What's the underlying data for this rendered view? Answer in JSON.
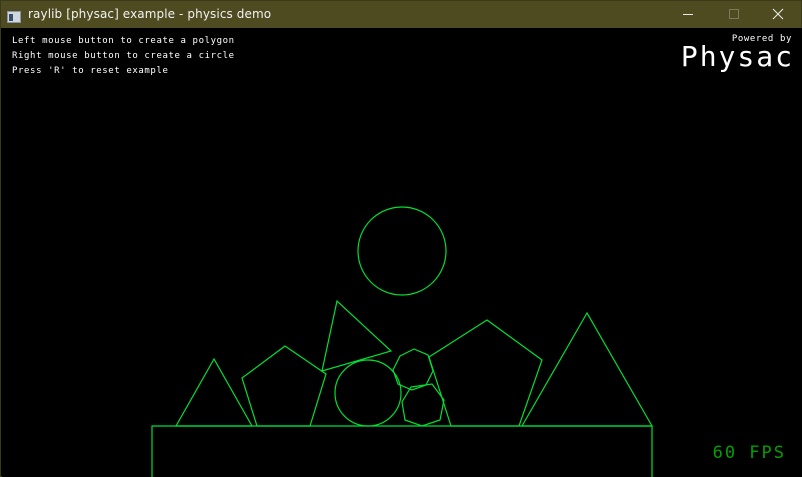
{
  "window": {
    "title": "raylib [physac] example - physics demo",
    "icon": "app-window-icon",
    "controls": [
      "minimize-icon",
      "maximize-icon",
      "close-icon"
    ]
  },
  "instructions": [
    "Left mouse button to create a polygon",
    "Right mouse button to create a circle",
    "Press 'R' to reset example"
  ],
  "logo": {
    "subtitle": "Powered by",
    "name": "Physac"
  },
  "fps_text": "60 FPS",
  "colors": {
    "titlebar": "#4d4b1f",
    "shape_outline": "#00e030",
    "fps": "#00a000",
    "background": "#000000"
  }
}
